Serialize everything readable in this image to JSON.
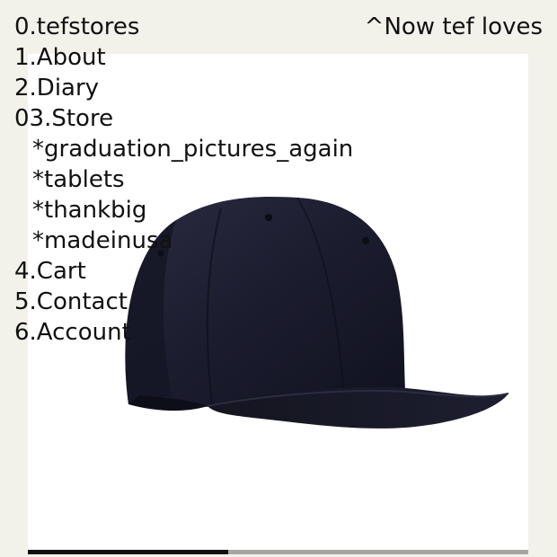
{
  "header": {
    "site_title": "0.tefstores",
    "now_loves": "^Now tef loves"
  },
  "nav": {
    "items": [
      {
        "label": "1.About"
      },
      {
        "label": "2.Diary"
      },
      {
        "label": "03.Store"
      },
      {
        "label": "*graduation_pictures_again"
      },
      {
        "label": "*tablets"
      },
      {
        "label": "*thankbig"
      },
      {
        "label": "*madeinusa"
      },
      {
        "label": "4.Cart"
      },
      {
        "label": "5.Contact"
      },
      {
        "label": "6.Account"
      }
    ]
  },
  "product": {
    "image_icon": "baseball-cap",
    "cap_color": "#1b1c2e"
  },
  "carousel": {
    "progress": 0.4
  },
  "colors": {
    "background": "#f2f1ea",
    "text": "#111111",
    "panel": "#ffffff"
  }
}
